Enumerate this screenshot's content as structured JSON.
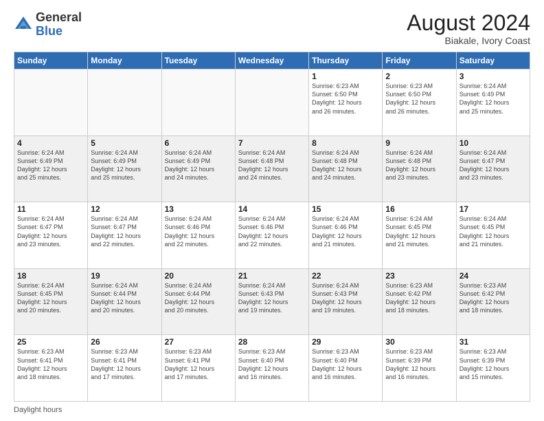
{
  "header": {
    "logo_general": "General",
    "logo_blue": "Blue",
    "month_year": "August 2024",
    "location": "Biakale, Ivory Coast"
  },
  "footer": {
    "daylight_label": "Daylight hours"
  },
  "days_of_week": [
    "Sunday",
    "Monday",
    "Tuesday",
    "Wednesday",
    "Thursday",
    "Friday",
    "Saturday"
  ],
  "weeks": [
    [
      {
        "day": "",
        "info": ""
      },
      {
        "day": "",
        "info": ""
      },
      {
        "day": "",
        "info": ""
      },
      {
        "day": "",
        "info": ""
      },
      {
        "day": "1",
        "info": "Sunrise: 6:23 AM\nSunset: 6:50 PM\nDaylight: 12 hours\nand 26 minutes."
      },
      {
        "day": "2",
        "info": "Sunrise: 6:23 AM\nSunset: 6:50 PM\nDaylight: 12 hours\nand 26 minutes."
      },
      {
        "day": "3",
        "info": "Sunrise: 6:24 AM\nSunset: 6:49 PM\nDaylight: 12 hours\nand 25 minutes."
      }
    ],
    [
      {
        "day": "4",
        "info": "Sunrise: 6:24 AM\nSunset: 6:49 PM\nDaylight: 12 hours\nand 25 minutes."
      },
      {
        "day": "5",
        "info": "Sunrise: 6:24 AM\nSunset: 6:49 PM\nDaylight: 12 hours\nand 25 minutes."
      },
      {
        "day": "6",
        "info": "Sunrise: 6:24 AM\nSunset: 6:49 PM\nDaylight: 12 hours\nand 24 minutes."
      },
      {
        "day": "7",
        "info": "Sunrise: 6:24 AM\nSunset: 6:48 PM\nDaylight: 12 hours\nand 24 minutes."
      },
      {
        "day": "8",
        "info": "Sunrise: 6:24 AM\nSunset: 6:48 PM\nDaylight: 12 hours\nand 24 minutes."
      },
      {
        "day": "9",
        "info": "Sunrise: 6:24 AM\nSunset: 6:48 PM\nDaylight: 12 hours\nand 23 minutes."
      },
      {
        "day": "10",
        "info": "Sunrise: 6:24 AM\nSunset: 6:47 PM\nDaylight: 12 hours\nand 23 minutes."
      }
    ],
    [
      {
        "day": "11",
        "info": "Sunrise: 6:24 AM\nSunset: 6:47 PM\nDaylight: 12 hours\nand 23 minutes."
      },
      {
        "day": "12",
        "info": "Sunrise: 6:24 AM\nSunset: 6:47 PM\nDaylight: 12 hours\nand 22 minutes."
      },
      {
        "day": "13",
        "info": "Sunrise: 6:24 AM\nSunset: 6:46 PM\nDaylight: 12 hours\nand 22 minutes."
      },
      {
        "day": "14",
        "info": "Sunrise: 6:24 AM\nSunset: 6:46 PM\nDaylight: 12 hours\nand 22 minutes."
      },
      {
        "day": "15",
        "info": "Sunrise: 6:24 AM\nSunset: 6:46 PM\nDaylight: 12 hours\nand 21 minutes."
      },
      {
        "day": "16",
        "info": "Sunrise: 6:24 AM\nSunset: 6:45 PM\nDaylight: 12 hours\nand 21 minutes."
      },
      {
        "day": "17",
        "info": "Sunrise: 6:24 AM\nSunset: 6:45 PM\nDaylight: 12 hours\nand 21 minutes."
      }
    ],
    [
      {
        "day": "18",
        "info": "Sunrise: 6:24 AM\nSunset: 6:45 PM\nDaylight: 12 hours\nand 20 minutes."
      },
      {
        "day": "19",
        "info": "Sunrise: 6:24 AM\nSunset: 6:44 PM\nDaylight: 12 hours\nand 20 minutes."
      },
      {
        "day": "20",
        "info": "Sunrise: 6:24 AM\nSunset: 6:44 PM\nDaylight: 12 hours\nand 20 minutes."
      },
      {
        "day": "21",
        "info": "Sunrise: 6:24 AM\nSunset: 6:43 PM\nDaylight: 12 hours\nand 19 minutes."
      },
      {
        "day": "22",
        "info": "Sunrise: 6:24 AM\nSunset: 6:43 PM\nDaylight: 12 hours\nand 19 minutes."
      },
      {
        "day": "23",
        "info": "Sunrise: 6:23 AM\nSunset: 6:42 PM\nDaylight: 12 hours\nand 18 minutes."
      },
      {
        "day": "24",
        "info": "Sunrise: 6:23 AM\nSunset: 6:42 PM\nDaylight: 12 hours\nand 18 minutes."
      }
    ],
    [
      {
        "day": "25",
        "info": "Sunrise: 6:23 AM\nSunset: 6:41 PM\nDaylight: 12 hours\nand 18 minutes."
      },
      {
        "day": "26",
        "info": "Sunrise: 6:23 AM\nSunset: 6:41 PM\nDaylight: 12 hours\nand 17 minutes."
      },
      {
        "day": "27",
        "info": "Sunrise: 6:23 AM\nSunset: 6:41 PM\nDaylight: 12 hours\nand 17 minutes."
      },
      {
        "day": "28",
        "info": "Sunrise: 6:23 AM\nSunset: 6:40 PM\nDaylight: 12 hours\nand 16 minutes."
      },
      {
        "day": "29",
        "info": "Sunrise: 6:23 AM\nSunset: 6:40 PM\nDaylight: 12 hours\nand 16 minutes."
      },
      {
        "day": "30",
        "info": "Sunrise: 6:23 AM\nSunset: 6:39 PM\nDaylight: 12 hours\nand 16 minutes."
      },
      {
        "day": "31",
        "info": "Sunrise: 6:23 AM\nSunset: 6:39 PM\nDaylight: 12 hours\nand 15 minutes."
      }
    ]
  ]
}
